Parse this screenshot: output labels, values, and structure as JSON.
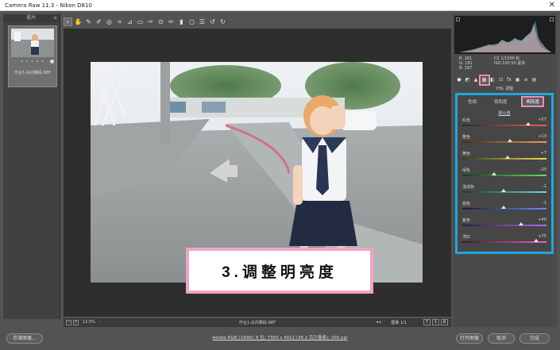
{
  "window": {
    "title": "Camera Raw 11.3  -  Nikon D810",
    "close_glyph": "✕"
  },
  "filmstrip": {
    "header": "胶片",
    "thumbnail": {
      "stars": "• • • • •",
      "filename": "作业1-白内障码.NEF"
    }
  },
  "toolbar": {
    "tools": [
      "zoom-icon",
      "hand-icon",
      "white-balance-icon",
      "color-sampler-icon",
      "target-adjust-icon",
      "crop-icon",
      "straighten-icon",
      "transform-icon",
      "spot-removal-icon",
      "red-eye-icon",
      "adjustment-brush-icon",
      "graduated-filter-icon",
      "radial-filter-icon",
      "presets-icon",
      "rotate-ccw-icon",
      "rotate-cw-icon"
    ]
  },
  "caption": {
    "text": "3.调整明亮度"
  },
  "statusbar": {
    "zoom_out": "−",
    "zoom_in": "+",
    "zoom": "12.5%",
    "zoom_dropdown": "⌄",
    "filename": "作业1-白内障码.NEF",
    "nav": "◂ ▸",
    "image_count": "图像 1/1",
    "view_buttons": [
      "Y",
      "⇕",
      "⚙"
    ]
  },
  "bottombar": {
    "save_label": "存储图像...",
    "workflow_link": "Adobe RGB (1998); 8 位; 7360 x 4912 (36.2 百万像素); 300 ppi",
    "open_label": "打开图像",
    "cancel_label": "取消",
    "done_label": "完成"
  },
  "readout": {
    "rgb": [
      "R:  181",
      "G:  181",
      "B:  187"
    ],
    "camera": [
      "f/2    1/1000 秒",
      "ISO 100    50 毫米"
    ]
  },
  "panel_icons": [
    "basic-icon",
    "tone-curve-icon",
    "detail-icon",
    "hsl-icon",
    "split-toning-icon",
    "lens-icon",
    "effects-icon",
    "calibration-icon",
    "presets-panel-icon",
    "snapshots-icon"
  ],
  "panel_header": "HSL 调整",
  "hsl": {
    "tabs": [
      "色相",
      "饱和度",
      "明亮度"
    ],
    "active_tab": 2,
    "default_link": "默认值",
    "sliders": [
      {
        "label": "红色",
        "value": "+57",
        "pos": 0.785,
        "gradient": [
          "#2a2a2a",
          "#f05a5a"
        ]
      },
      {
        "label": "橙色",
        "value": "+13",
        "pos": 0.565,
        "gradient": [
          "#3a2a1a",
          "#f0a050"
        ]
      },
      {
        "label": "黄色",
        "value": "+7",
        "pos": 0.535,
        "gradient": [
          "#3a3a1a",
          "#f0e050"
        ]
      },
      {
        "label": "绿色",
        "value": "-25",
        "pos": 0.375,
        "gradient": [
          "#1a3a1a",
          "#60e060"
        ]
      },
      {
        "label": "浅绿色",
        "value": "-1",
        "pos": 0.495,
        "gradient": [
          "#1a3a3a",
          "#60e0e0"
        ]
      },
      {
        "label": "蓝色",
        "value": "-1",
        "pos": 0.495,
        "gradient": [
          "#1a1a3a",
          "#6090f0"
        ]
      },
      {
        "label": "紫色",
        "value": "+40",
        "pos": 0.7,
        "gradient": [
          "#2a1a3a",
          "#b070f0"
        ]
      },
      {
        "label": "洋红",
        "value": "+75",
        "pos": 0.875,
        "gradient": [
          "#3a1a2a",
          "#f060c0"
        ]
      }
    ]
  }
}
